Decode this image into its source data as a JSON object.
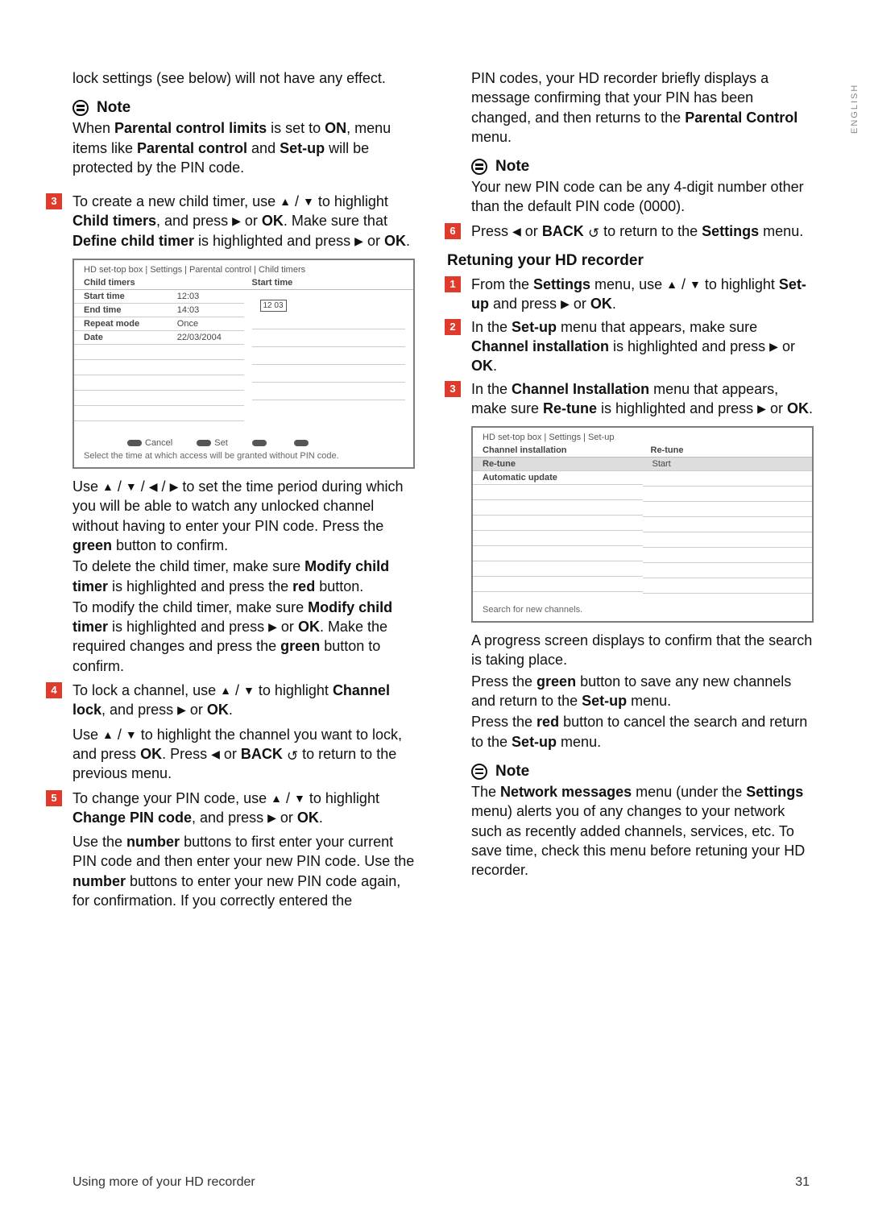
{
  "lang_tab": "ENGLISH",
  "left": {
    "intro": "lock settings (see below) will not have any effect.",
    "note1_title": "Note",
    "note1_l1a": "When ",
    "note1_l1b": "Parental control limits",
    "note1_l1c": " is set to ",
    "note1_l2a": "ON",
    "note1_l2b": ", menu items like ",
    "note1_l2c": "Parental control",
    "note1_l2d": " and ",
    "note1_l3a": "Set-up",
    "note1_l3b": " will be protected by the PIN code.",
    "step3_num": "3",
    "step3_a": "To create a new child timer, use ",
    "step3_b": " to highlight ",
    "step3_c": "Child timers",
    "step3_d": ", and press ",
    "step3_e": " or ",
    "step3_f": "OK",
    "step3_g": ". Make sure that ",
    "step3_h": "Define child timer",
    "step3_i": " is highlighted and press ",
    "step3_j": " or ",
    "step3_k": "OK",
    "step3_l": ".",
    "shot1": {
      "crumb": "HD set-top box | Settings | Parental control | Child timers",
      "col_left": "Child timers",
      "col_right": "Start time",
      "rows": [
        {
          "k": "Start time",
          "v": "12:03"
        },
        {
          "k": "End time",
          "v": "14:03"
        },
        {
          "k": "Repeat mode",
          "v": "Once"
        },
        {
          "k": "Date",
          "v": "22/03/2004"
        }
      ],
      "timebox": "12 03",
      "btn_cancel": "Cancel",
      "btn_set": "Set",
      "hint": "Select the time at which access will be granted without PIN code."
    },
    "p_after_shot_a": "Use ",
    "p_after_shot_b": " to set the time period during which you will be able to watch any unlocked channel without having to enter your PIN code. Press the ",
    "p_after_shot_c": "green",
    "p_after_shot_d": " button to confirm.",
    "p_del_a": "To delete the child timer, make sure ",
    "p_del_b": "Modify child timer",
    "p_del_c": " is highlighted and press the ",
    "p_del_d": "red",
    "p_del_e": " button.",
    "p_mod_a": "To modify the child timer, make sure ",
    "p_mod_b": "Modify child timer",
    "p_mod_c": " is highlighted and press ",
    "p_mod_d": " or ",
    "p_mod_e": "OK",
    "p_mod_f": ". Make the required changes and press the ",
    "p_mod_g": "green",
    "p_mod_h": " button to confirm.",
    "step4_num": "4",
    "step4_a": "To lock a channel, use ",
    "step4_b": " to highlight ",
    "step4_c": "Channel lock",
    "step4_d": ", and press ",
    "step4_e": " or ",
    "step4_f": "OK",
    "step4_g": ".",
    "p_lock_a": "Use ",
    "p_lock_b": " to highlight the channel you want to lock, and press ",
    "p_lock_c": "OK",
    "p_lock_d": ". Press ",
    "p_lock_e": " or ",
    "p_lock_f": "BACK",
    "p_lock_g": " to return to the previous menu.",
    "step5_num": "5",
    "step5_a": "To change your PIN code, use ",
    "step5_b": " to highlight ",
    "step5_c": "Change PIN code",
    "step5_d": ", and press ",
    "step5_e": " or ",
    "step5_f": "OK",
    "step5_g": ".",
    "p_pin_a": "Use the ",
    "p_pin_b": "number",
    "p_pin_c": " buttons to first enter your current PIN code and then enter your new PIN code. Use the ",
    "p_pin_d": "number",
    "p_pin_e": " buttons to enter your new PIN code again, for confirmation. If you correctly entered the "
  },
  "right": {
    "cont_a": "PIN codes, your HD recorder briefly displays a message confirming that your PIN has been changed, and then returns to the ",
    "cont_b": "Parental Control",
    "cont_c": " menu.",
    "note2_title": "Note",
    "note2_text": "Your new PIN code can be any 4-digit number other than the default PIN code (0000).",
    "step6_num": "6",
    "step6_a": "Press ",
    "step6_b": " or ",
    "step6_c": "BACK",
    "step6_d": " to return to the ",
    "step6_e": "Settings",
    "step6_f": " menu.",
    "heading": "Retuning your HD recorder",
    "r1_num": "1",
    "r1_a": "From the ",
    "r1_b": "Settings",
    "r1_c": " menu, use ",
    "r1_d": " to highlight ",
    "r1_e": "Set-up",
    "r1_f": " and press ",
    "r1_g": " or ",
    "r1_h": "OK",
    "r1_i": ".",
    "r2_num": "2",
    "r2_a": "In the ",
    "r2_b": "Set-up",
    "r2_c": " menu that appears, make sure ",
    "r2_d": "Channel installation",
    "r2_e": " is highlighted and press ",
    "r2_f": " or ",
    "r2_g": "OK",
    "r2_h": ".",
    "r3_num": "3",
    "r3_a": "In the ",
    "r3_b": "Channel Installation",
    "r3_c": " menu that appears, make sure ",
    "r3_d": "Re-tune",
    "r3_e": " is highlighted and press ",
    "r3_f": " or ",
    "r3_g": "OK",
    "r3_h": ".",
    "shot2": {
      "crumb": "HD set-top box | Settings | Set-up",
      "col_left": "Channel installation",
      "col_right": "Re-tune",
      "rows": [
        {
          "k": "Re-tune",
          "sel": true
        },
        {
          "k": "Automatic update",
          "sel": false
        }
      ],
      "right_val": "Start",
      "hint": "Search for new channels."
    },
    "p_prog": "A progress screen displays to confirm that the search is taking place.",
    "p_green_a": "Press the ",
    "p_green_b": "green",
    "p_green_c": " button to save any new channels and return to the ",
    "p_green_d": "Set-up",
    "p_green_e": " menu.",
    "p_red_a": "Press the ",
    "p_red_b": "red",
    "p_red_c": " button to cancel the search and return to the ",
    "p_red_d": "Set-up",
    "p_red_e": " menu.",
    "note3_title": "Note",
    "note3_a": "The ",
    "note3_b": "Network messages",
    "note3_c": " menu (under the ",
    "note3_d": "Settings",
    "note3_e": " menu) alerts you of any changes to your network such as recently added channels, services, etc. To save time, check this menu before retuning your HD recorder."
  },
  "footer_left": "Using more of your HD recorder",
  "footer_right": "31"
}
